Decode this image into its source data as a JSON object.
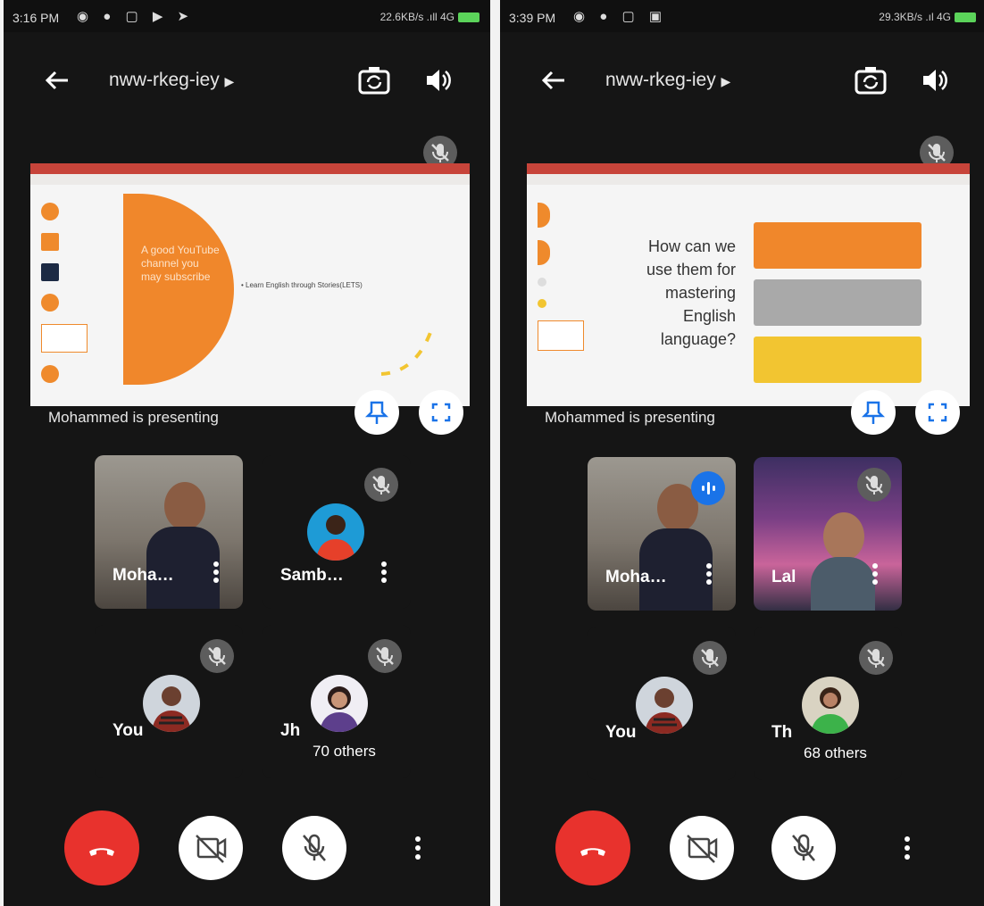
{
  "left": {
    "status": {
      "time": "3:16 PM",
      "network": "22.6KB/s .ıll 4G"
    },
    "meeting_code": "nww-rkeg-iey",
    "slide": {
      "big_text": "A good YouTube channel you may subscribe",
      "bullet": "• Learn English through Stories(LETS)"
    },
    "presenting_text": "Mohammed is presenting",
    "tiles": [
      {
        "name": "Moha…"
      },
      {
        "name": "Samb…"
      },
      {
        "name": "You"
      },
      {
        "name": "Jh"
      }
    ],
    "others": "70 others"
  },
  "right": {
    "status": {
      "time": "3:39 PM",
      "network": "29.3KB/s .ıl 4G"
    },
    "meeting_code": "nww-rkeg-iey",
    "slide": {
      "question": "How can we use them for mastering English language?"
    },
    "presenting_text": "Mohammed is presenting",
    "tiles": [
      {
        "name": "Moha…"
      },
      {
        "name": "Lal"
      },
      {
        "name": "You"
      },
      {
        "name": "Th"
      }
    ],
    "others": "68 others"
  },
  "icons": [
    "back-arrow-icon",
    "camera-flip-icon",
    "speaker-icon",
    "mic-off-icon",
    "pin-icon",
    "fullscreen-icon",
    "more-vert-icon",
    "end-call-icon",
    "camera-off-icon"
  ],
  "colors": {
    "end_call": "#e8322d",
    "speaking": "#1a73e8",
    "slide_orange": "#f0872b",
    "slide_yellow": "#f2c531"
  }
}
